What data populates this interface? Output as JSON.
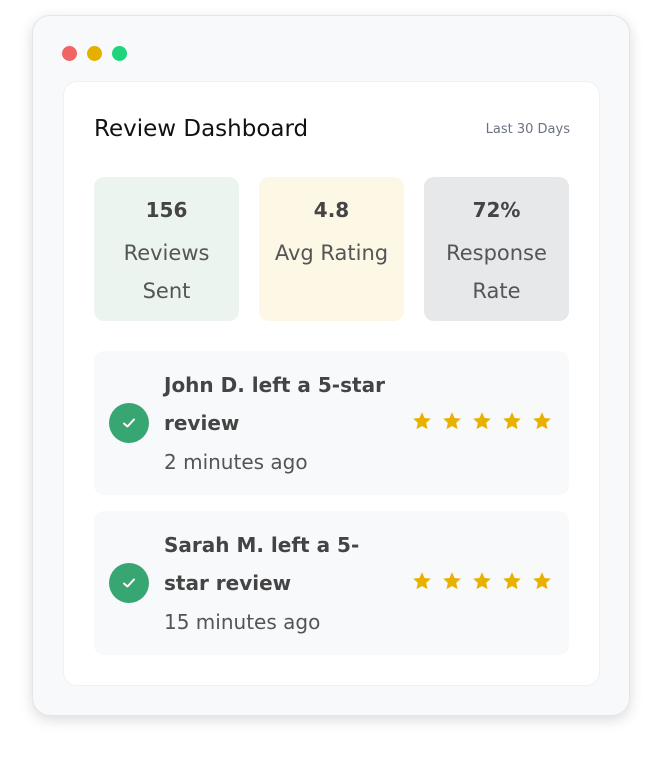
{
  "header": {
    "title": "Review Dashboard",
    "period": "Last 30 Days"
  },
  "stats": [
    {
      "value": "156",
      "label": "Reviews Sent",
      "color": "#ebf4ee"
    },
    {
      "value": "4.8",
      "label": "Avg Rating",
      "color": "#fdf7e6"
    },
    {
      "value": "72%",
      "label": "Response Rate",
      "color": "#e7e8e9"
    }
  ],
  "activity": [
    {
      "title": "John D. left a 5-star review",
      "time": "2 minutes ago",
      "rating": 5,
      "icon": "check-icon"
    },
    {
      "title": "Sarah M. left a 5-star review",
      "time": "15 minutes ago",
      "rating": 5,
      "icon": "check-icon"
    }
  ],
  "colors": {
    "accent_green": "#38a672",
    "star": "#e8b100",
    "window_dot_red": "#f26464",
    "window_dot_yellow": "#e6b000",
    "window_dot_green": "#1fd47b"
  }
}
